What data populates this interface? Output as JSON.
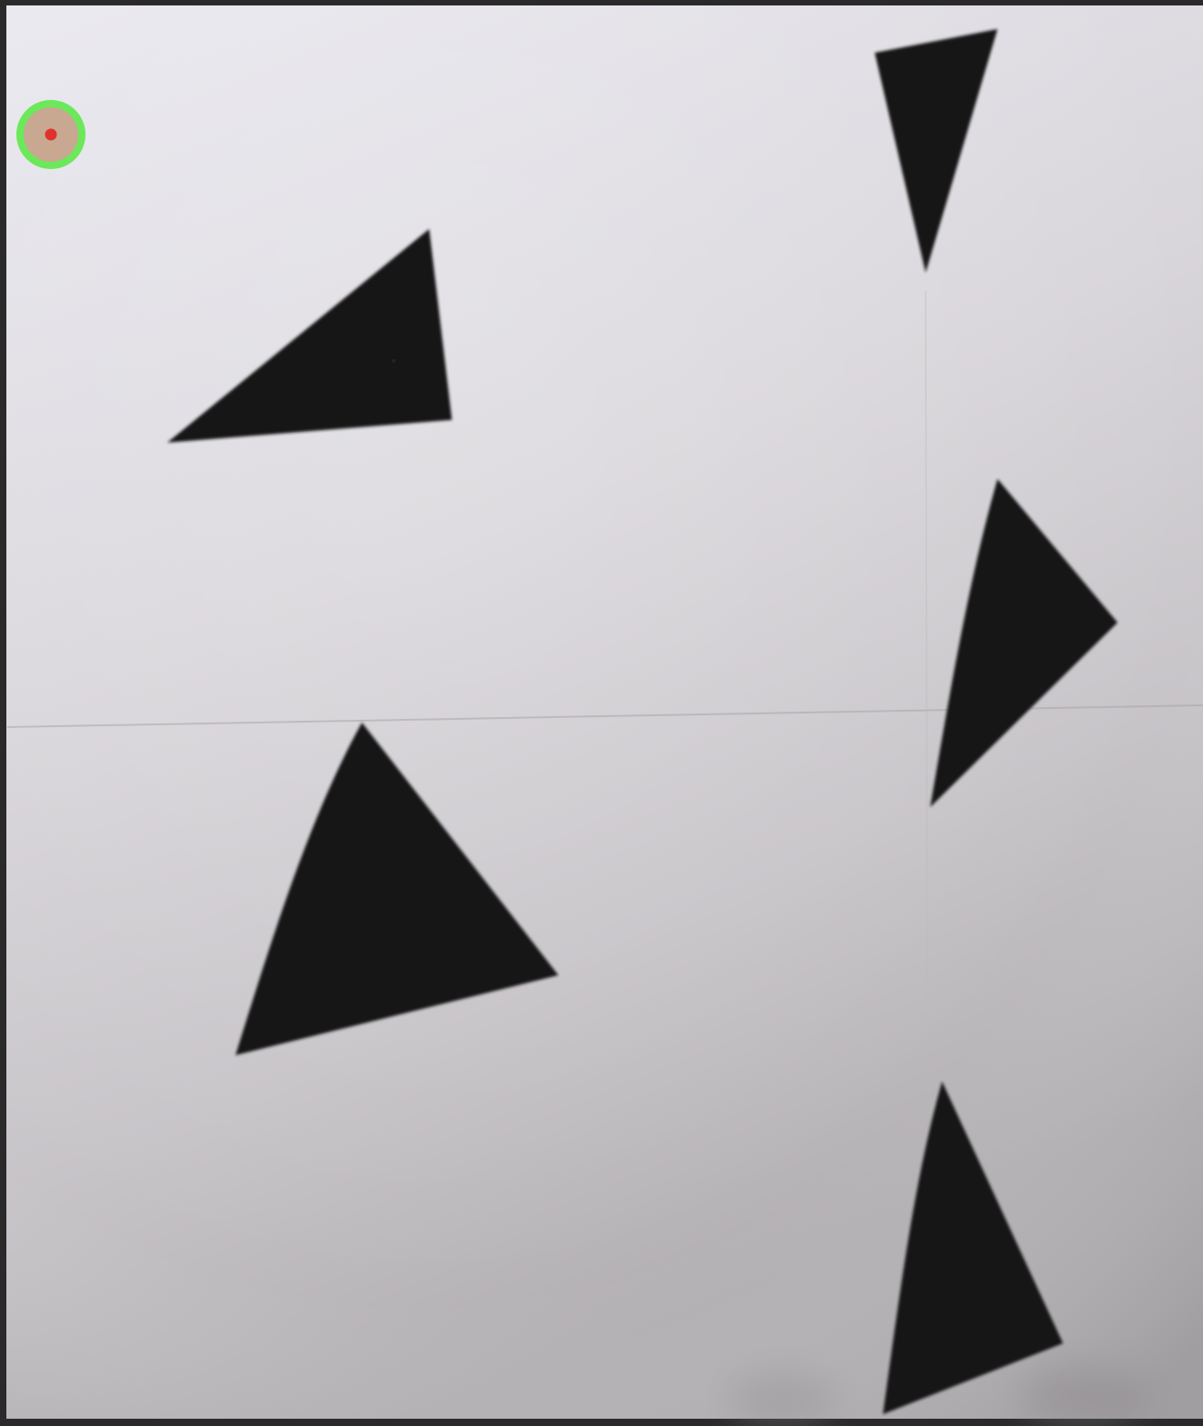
{
  "scene": {
    "description_free": true,
    "colors": {
      "frame_border": "#2a2a2a",
      "paper_light": "#e6e5ec",
      "paper_mid": "#d4d1d6",
      "paper_shadow": "#b7b5b9",
      "triangle_fill": "#141414",
      "marker_ring": "#5ee84a",
      "marker_fill": "#c8a890",
      "marker_dot": "#e0322c"
    },
    "shape_count": 6,
    "marker": {
      "icon": "gaze-marker-icon"
    }
  }
}
